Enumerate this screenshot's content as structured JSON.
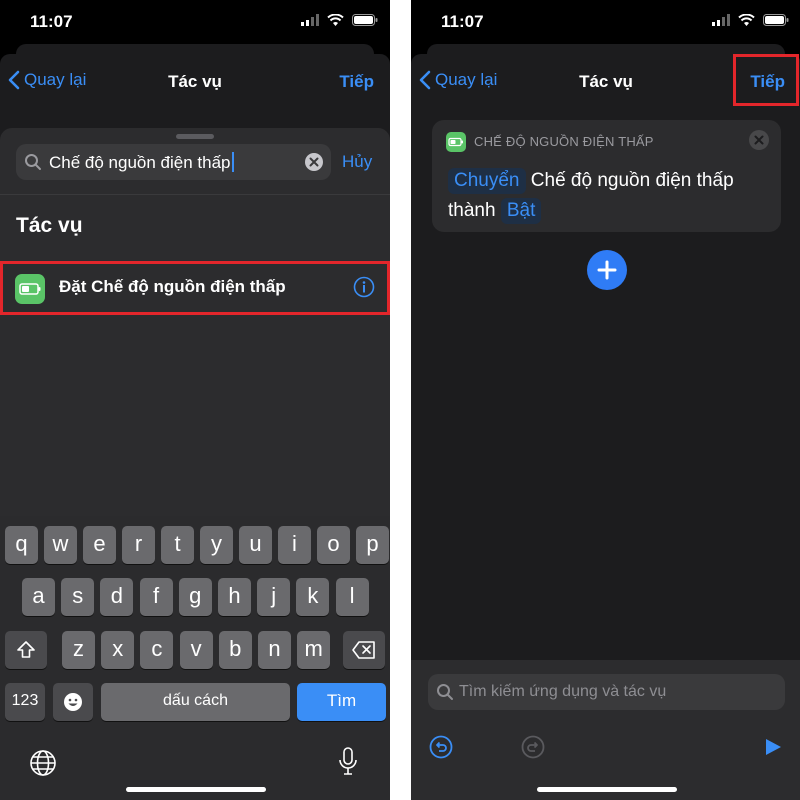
{
  "left": {
    "status": {
      "time": "11:07"
    },
    "nav": {
      "back": "Quay lại",
      "title": "Tác vụ",
      "next": "Tiếp"
    },
    "search": {
      "query": "Chế độ nguồn điện thấp",
      "cancel": "Hủy"
    },
    "section_title": "Tác vụ",
    "result": {
      "label": "Đặt Chế độ nguồn điện thấp"
    },
    "keyboard": {
      "row1": [
        "q",
        "w",
        "e",
        "r",
        "t",
        "y",
        "u",
        "i",
        "o",
        "p"
      ],
      "row2": [
        "a",
        "s",
        "d",
        "f",
        "g",
        "h",
        "j",
        "k",
        "l"
      ],
      "row3": [
        "z",
        "x",
        "c",
        "v",
        "b",
        "n",
        "m"
      ],
      "numbers": "123",
      "space": "dấu cách",
      "go": "Tìm"
    }
  },
  "right": {
    "status": {
      "time": "11:07"
    },
    "nav": {
      "back": "Quay lại",
      "title": "Tác vụ",
      "next": "Tiếp"
    },
    "action": {
      "category": "CHẾ ĐỘ NGUỒN ĐIỆN THẤP",
      "verb": "Chuyển",
      "text1": "Chế độ nguồn điện",
      "text2": "thấp thành",
      "value": "Bật"
    },
    "search_placeholder": "Tìm kiếm ứng dụng và tác vụ"
  },
  "colors": {
    "accent": "#3a8ef6",
    "highlight": "#e3262b",
    "battery_green": "#5ac467"
  }
}
